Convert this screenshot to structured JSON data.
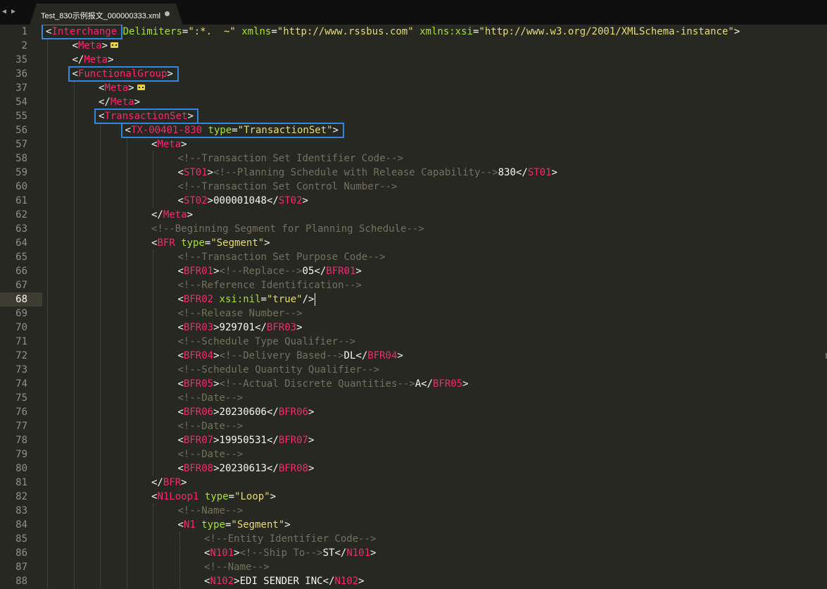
{
  "tabbar": {
    "nav_left": "◀",
    "nav_right": "▶",
    "tab_title": "Test_830示例报文_000000333.xml",
    "tab_modified_icon": "dot-icon"
  },
  "colors": {
    "background": "#272822",
    "tag": "#f92672",
    "attribute": "#a6e22e",
    "string": "#e6db74",
    "comment": "#75715e",
    "text": "#f8f8f2",
    "highlight_box": "#2f87e2"
  },
  "editor": {
    "current_line": "68",
    "lines": [
      {
        "n": "1",
        "indent": 0,
        "tokens": [
          [
            "p",
            "<"
          ],
          [
            "t",
            "Interchange"
          ],
          [
            "p",
            " "
          ],
          [
            "a",
            "Delimiters"
          ],
          [
            "p",
            "="
          ],
          [
            "s",
            "\":*.  ~\""
          ],
          [
            "p",
            " "
          ],
          [
            "a",
            "xmlns"
          ],
          [
            "p",
            "="
          ],
          [
            "s",
            "\"http://www.rssbus.com\""
          ],
          [
            "p",
            " "
          ],
          [
            "a",
            "xmlns:xsi"
          ],
          [
            "p",
            "="
          ],
          [
            "s",
            "\"http://www.w3.org/2001/XMLSchema-instance\""
          ],
          [
            "p",
            ">"
          ]
        ]
      },
      {
        "n": "2",
        "indent": 1,
        "tokens": [
          [
            "p",
            "<"
          ],
          [
            "t",
            "Meta"
          ],
          [
            "p",
            ">"
          ]
        ],
        "fold": true
      },
      {
        "n": "35",
        "indent": 1,
        "tokens": [
          [
            "p",
            "</"
          ],
          [
            "t",
            "Meta"
          ],
          [
            "p",
            ">"
          ]
        ]
      },
      {
        "n": "36",
        "indent": 1,
        "tokens": [
          [
            "p",
            "<"
          ],
          [
            "t",
            "FunctionalGroup"
          ],
          [
            "p",
            ">"
          ]
        ]
      },
      {
        "n": "37",
        "indent": 2,
        "tokens": [
          [
            "p",
            "<"
          ],
          [
            "t",
            "Meta"
          ],
          [
            "p",
            ">"
          ]
        ],
        "fold": true
      },
      {
        "n": "54",
        "indent": 2,
        "tokens": [
          [
            "p",
            "</"
          ],
          [
            "t",
            "Meta"
          ],
          [
            "p",
            ">"
          ]
        ]
      },
      {
        "n": "55",
        "indent": 2,
        "tokens": [
          [
            "p",
            "<"
          ],
          [
            "t",
            "TransactionSet"
          ],
          [
            "p",
            ">"
          ]
        ]
      },
      {
        "n": "56",
        "indent": 3,
        "tokens": [
          [
            "p",
            "<"
          ],
          [
            "t",
            "TX-00401-830"
          ],
          [
            "p",
            " "
          ],
          [
            "a",
            "type"
          ],
          [
            "p",
            "="
          ],
          [
            "s",
            "\"TransactionSet\""
          ],
          [
            "p",
            ">"
          ]
        ]
      },
      {
        "n": "57",
        "indent": 4,
        "tokens": [
          [
            "p",
            "<"
          ],
          [
            "t",
            "Meta"
          ],
          [
            "p",
            ">"
          ]
        ]
      },
      {
        "n": "58",
        "indent": 5,
        "tokens": [
          [
            "c",
            "<!--Transaction Set Identifier Code-->"
          ]
        ]
      },
      {
        "n": "59",
        "indent": 5,
        "tokens": [
          [
            "p",
            "<"
          ],
          [
            "t",
            "ST01"
          ],
          [
            "p",
            ">"
          ],
          [
            "c",
            "<!--Planning Schedule with Release Capability-->"
          ],
          [
            "p",
            "830</"
          ],
          [
            "t",
            "ST01"
          ],
          [
            "p",
            ">"
          ]
        ]
      },
      {
        "n": "60",
        "indent": 5,
        "tokens": [
          [
            "c",
            "<!--Transaction Set Control Number-->"
          ]
        ]
      },
      {
        "n": "61",
        "indent": 5,
        "tokens": [
          [
            "p",
            "<"
          ],
          [
            "t",
            "ST02"
          ],
          [
            "p",
            ">000001048</"
          ],
          [
            "t",
            "ST02"
          ],
          [
            "p",
            ">"
          ]
        ]
      },
      {
        "n": "62",
        "indent": 4,
        "tokens": [
          [
            "p",
            "</"
          ],
          [
            "t",
            "Meta"
          ],
          [
            "p",
            ">"
          ]
        ]
      },
      {
        "n": "63",
        "indent": 4,
        "tokens": [
          [
            "c",
            "<!--Beginning Segment for Planning Schedule-->"
          ]
        ]
      },
      {
        "n": "64",
        "indent": 4,
        "tokens": [
          [
            "p",
            "<"
          ],
          [
            "t",
            "BFR"
          ],
          [
            "p",
            " "
          ],
          [
            "a",
            "type"
          ],
          [
            "p",
            "="
          ],
          [
            "s",
            "\"Segment\""
          ],
          [
            "p",
            ">"
          ]
        ]
      },
      {
        "n": "65",
        "indent": 5,
        "tokens": [
          [
            "c",
            "<!--Transaction Set Purpose Code-->"
          ]
        ]
      },
      {
        "n": "66",
        "indent": 5,
        "tokens": [
          [
            "p",
            "<"
          ],
          [
            "t",
            "BFR01"
          ],
          [
            "p",
            ">"
          ],
          [
            "c",
            "<!--Replace-->"
          ],
          [
            "p",
            "05</"
          ],
          [
            "t",
            "BFR01"
          ],
          [
            "p",
            ">"
          ]
        ]
      },
      {
        "n": "67",
        "indent": 5,
        "tokens": [
          [
            "c",
            "<!--Reference Identification-->"
          ]
        ]
      },
      {
        "n": "68",
        "indent": 5,
        "tokens": [
          [
            "p",
            "<"
          ],
          [
            "t",
            "BFR02"
          ],
          [
            "p",
            " "
          ],
          [
            "a",
            "xsi:nil"
          ],
          [
            "p",
            "="
          ],
          [
            "s",
            "\"true\""
          ],
          [
            "p",
            "/>"
          ]
        ],
        "caret": true
      },
      {
        "n": "69",
        "indent": 5,
        "tokens": [
          [
            "c",
            "<!--Release Number-->"
          ]
        ]
      },
      {
        "n": "70",
        "indent": 5,
        "tokens": [
          [
            "p",
            "<"
          ],
          [
            "t",
            "BFR03"
          ],
          [
            "p",
            ">929701</"
          ],
          [
            "t",
            "BFR03"
          ],
          [
            "p",
            ">"
          ]
        ]
      },
      {
        "n": "71",
        "indent": 5,
        "tokens": [
          [
            "c",
            "<!--Schedule Type Qualifier-->"
          ]
        ]
      },
      {
        "n": "72",
        "indent": 5,
        "tokens": [
          [
            "p",
            "<"
          ],
          [
            "t",
            "BFR04"
          ],
          [
            "p",
            ">"
          ],
          [
            "c",
            "<!--Delivery Based-->"
          ],
          [
            "p",
            "DL</"
          ],
          [
            "t",
            "BFR04"
          ],
          [
            "p",
            ">"
          ]
        ]
      },
      {
        "n": "73",
        "indent": 5,
        "tokens": [
          [
            "c",
            "<!--Schedule Quantity Qualifier-->"
          ]
        ]
      },
      {
        "n": "74",
        "indent": 5,
        "tokens": [
          [
            "p",
            "<"
          ],
          [
            "t",
            "BFR05"
          ],
          [
            "p",
            ">"
          ],
          [
            "c",
            "<!--Actual Discrete Quantities-->"
          ],
          [
            "p",
            "A</"
          ],
          [
            "t",
            "BFR05"
          ],
          [
            "p",
            ">"
          ]
        ]
      },
      {
        "n": "75",
        "indent": 5,
        "tokens": [
          [
            "c",
            "<!--Date-->"
          ]
        ]
      },
      {
        "n": "76",
        "indent": 5,
        "tokens": [
          [
            "p",
            "<"
          ],
          [
            "t",
            "BFR06"
          ],
          [
            "p",
            ">20230606</"
          ],
          [
            "t",
            "BFR06"
          ],
          [
            "p",
            ">"
          ]
        ]
      },
      {
        "n": "77",
        "indent": 5,
        "tokens": [
          [
            "c",
            "<!--Date-->"
          ]
        ]
      },
      {
        "n": "78",
        "indent": 5,
        "tokens": [
          [
            "p",
            "<"
          ],
          [
            "t",
            "BFR07"
          ],
          [
            "p",
            ">19950531</"
          ],
          [
            "t",
            "BFR07"
          ],
          [
            "p",
            ">"
          ]
        ]
      },
      {
        "n": "79",
        "indent": 5,
        "tokens": [
          [
            "c",
            "<!--Date-->"
          ]
        ]
      },
      {
        "n": "80",
        "indent": 5,
        "tokens": [
          [
            "p",
            "<"
          ],
          [
            "t",
            "BFR08"
          ],
          [
            "p",
            ">20230613</"
          ],
          [
            "t",
            "BFR08"
          ],
          [
            "p",
            ">"
          ]
        ]
      },
      {
        "n": "81",
        "indent": 4,
        "tokens": [
          [
            "p",
            "</"
          ],
          [
            "t",
            "BFR"
          ],
          [
            "p",
            ">"
          ]
        ]
      },
      {
        "n": "82",
        "indent": 4,
        "tokens": [
          [
            "p",
            "<"
          ],
          [
            "t",
            "N1Loop1"
          ],
          [
            "p",
            " "
          ],
          [
            "a",
            "type"
          ],
          [
            "p",
            "="
          ],
          [
            "s",
            "\"Loop\""
          ],
          [
            "p",
            ">"
          ]
        ]
      },
      {
        "n": "83",
        "indent": 5,
        "tokens": [
          [
            "c",
            "<!--Name-->"
          ]
        ]
      },
      {
        "n": "84",
        "indent": 5,
        "tokens": [
          [
            "p",
            "<"
          ],
          [
            "t",
            "N1"
          ],
          [
            "p",
            " "
          ],
          [
            "a",
            "type"
          ],
          [
            "p",
            "="
          ],
          [
            "s",
            "\"Segment\""
          ],
          [
            "p",
            ">"
          ]
        ]
      },
      {
        "n": "85",
        "indent": 6,
        "tokens": [
          [
            "c",
            "<!--Entity Identifier Code-->"
          ]
        ]
      },
      {
        "n": "86",
        "indent": 6,
        "tokens": [
          [
            "p",
            "<"
          ],
          [
            "t",
            "N101"
          ],
          [
            "p",
            ">"
          ],
          [
            "c",
            "<!--Ship To-->"
          ],
          [
            "p",
            "ST</"
          ],
          [
            "t",
            "N101"
          ],
          [
            "p",
            ">"
          ]
        ]
      },
      {
        "n": "87",
        "indent": 6,
        "tokens": [
          [
            "c",
            "<!--Name-->"
          ]
        ]
      },
      {
        "n": "88",
        "indent": 6,
        "tokens": [
          [
            "p",
            "<"
          ],
          [
            "t",
            "N102"
          ],
          [
            "p",
            ">EDI SENDER INC</"
          ],
          [
            "t",
            "N102"
          ],
          [
            "p",
            ">"
          ]
        ]
      }
    ]
  }
}
